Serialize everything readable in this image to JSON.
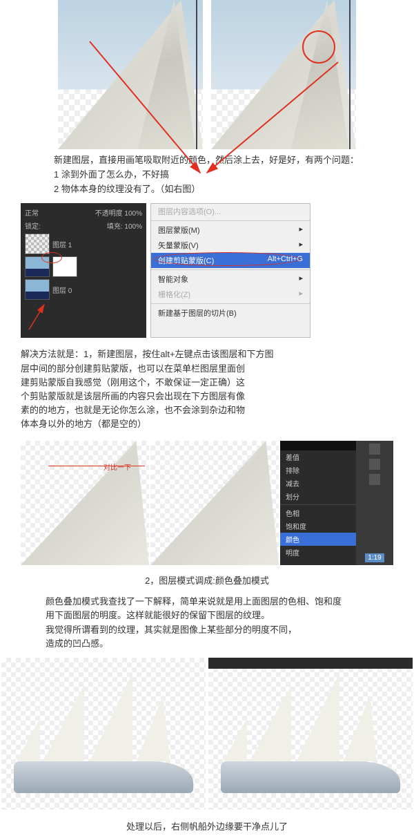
{
  "top": {
    "caption_line1": "新建图层，直接用画笔吸取附近的颜色，然后涂上去，好是好，有两个问题：",
    "caption_line2": "1  涂到外面了怎么办，不好搞",
    "caption_line3": "2  物体本身的纹理没有了。（如右图）",
    "compare_note": "对比一下"
  },
  "ps_menu": {
    "opt0": "图层内容选项(O)...",
    "opt1": "图层蒙版(M)",
    "opt2": "矢量蒙版(V)",
    "opt3_label": "创建剪贴蒙版(C)",
    "opt3_short": "Alt+Ctrl+G",
    "opt4": "智能对象",
    "opt5": "栅格化(Z)",
    "opt6": "新建基于图层的切片(B)"
  },
  "layers_panel": {
    "tab": "正常",
    "opacity_label": "不透明度",
    "opacity": "100%",
    "lock": "锁定:",
    "fill": "填充: 100%",
    "layer1": "图层 1",
    "layer0": "图层 0"
  },
  "solution": {
    "l1": "解决方法就是：1，新建图层，按住alt+左键点击该图层和下方图",
    "l2": "层中间的部分创建剪贴蒙版，也可以在菜单栏图层里面创",
    "l3": "建剪贴蒙版自我感觉（刚用这个，不敢保证一定正确）这",
    "l4": "个剪贴蒙版就是该层所画的内容只会出现在下方图层有像",
    "l5": "素的的地方，也就是无论你怎么涂，也不会涂到杂边和物",
    "l6": "体本身以外的地方（都是空的）"
  },
  "blend_menu": {
    "b1": "差值",
    "b2": "排除",
    "b3": "减去",
    "b4": "划分",
    "b5": "色相",
    "b6": "饱和度",
    "b7": "颜色",
    "b8": "明度"
  },
  "time_badge": "1:19",
  "step2_caption": "2，图层模式调成:颜色叠加模式",
  "color_mode": {
    "l1": "颜色叠加模式我查找了一下解释，简单来说就是用上面图层的色相、饱和度",
    "l2": "用下面图层的明度。这样就能很好的保留下图层的纹理。",
    "l3": "我觉得所谓看到的纹理，其实就是图像上某些部分的明度不同，",
    "l4": "造成的凹凸感。"
  },
  "final_caption": "处理以后，右侧帆船外边缘要干净点儿了"
}
